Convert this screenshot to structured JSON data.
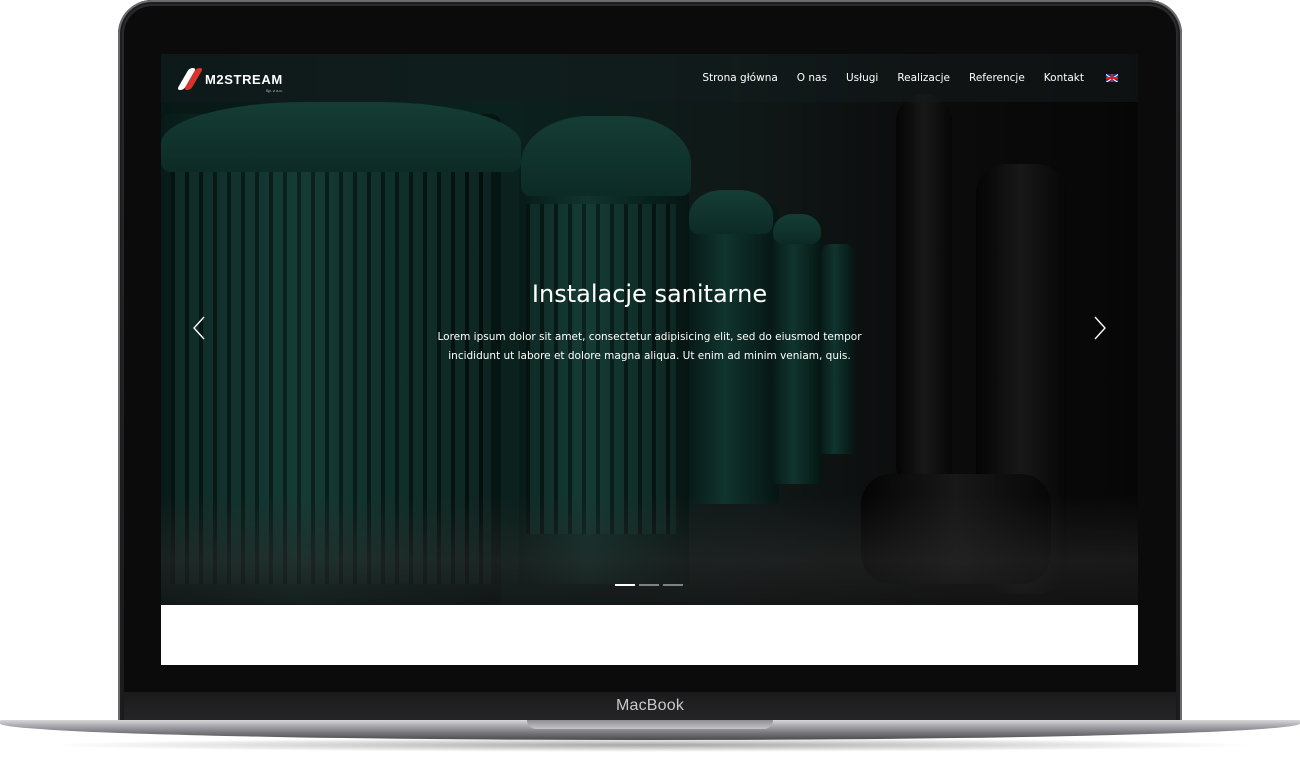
{
  "device": {
    "label": "MacBook"
  },
  "site": {
    "logo": {
      "name": "M2STREAM",
      "subtitle": "Sp. z o.o."
    },
    "nav": {
      "items": [
        {
          "label": "Strona główna"
        },
        {
          "label": "O nas"
        },
        {
          "label": "Usługi"
        },
        {
          "label": "Realizacje"
        },
        {
          "label": "Referencje"
        },
        {
          "label": "Kontakt"
        }
      ],
      "language_icon": "uk-flag-icon"
    },
    "carousel": {
      "title": "Instalacje sanitarne",
      "text": "Lorem ipsum dolor sit amet, consectetur adipisicing elit, sed do eiusmod tempor incididunt ut labore et dolore magna aliqua. Ut enim ad minim veniam, quis.",
      "prev_icon": "chevron-left-icon",
      "next_icon": "chevron-right-icon",
      "slide_count": 3,
      "active_slide": 1
    }
  },
  "colors": {
    "accent_red": "#d9332b",
    "pump_green": "#1d5a50"
  }
}
